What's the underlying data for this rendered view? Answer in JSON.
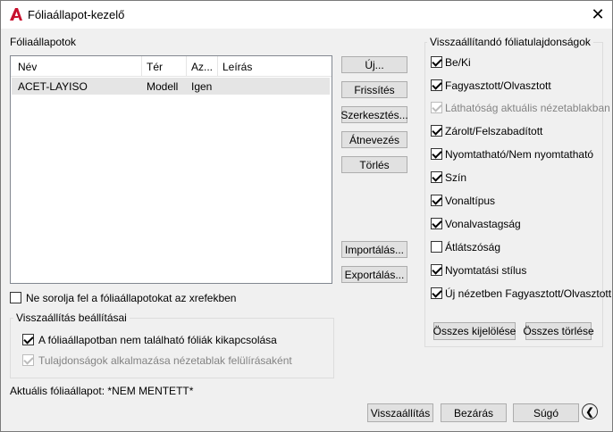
{
  "window": {
    "title": "Fóliaállapot-kezelő",
    "close_glyph": "✕",
    "app_icon": "autocad-icon"
  },
  "left": {
    "list_label": "Fóliaállapotok",
    "columns": [
      "Név",
      "Tér",
      "Az...",
      "Leírás"
    ],
    "rows": [
      {
        "name": "ACET-LAYISO",
        "space": "Modell",
        "az": "Igen",
        "desc": ""
      }
    ],
    "xref_checkbox": {
      "label": "Ne sorolja fel a fóliaállapotokat az xrefekben",
      "checked": false
    },
    "restore_group": {
      "title": "Visszaállítás beállításai",
      "opt1": {
        "label": "A fóliaállapotban nem található fóliák kikapcsolása",
        "checked": true
      },
      "opt2": {
        "label": "Tulajdonságok alkalmazása nézetablak felülírásaként",
        "checked": true,
        "disabled": true
      }
    },
    "current_state": "Aktuális fóliaállapot: *NEM MENTETT*"
  },
  "middle_buttons": {
    "new": "Új...",
    "refresh": "Frissítés",
    "edit": "Szerkesztés...",
    "rename": "Átnevezés",
    "delete": "Törlés",
    "import": "Importálás...",
    "export": "Exportálás..."
  },
  "right": {
    "group_title": "Visszaállítandó fóliatulajdonságok",
    "props": [
      {
        "label": "Be/Ki",
        "checked": true,
        "disabled": false
      },
      {
        "label": "Fagyasztott/Olvasztott",
        "checked": true,
        "disabled": false
      },
      {
        "label": "Láthatóság aktuális nézetablakban",
        "checked": true,
        "disabled": true
      },
      {
        "label": "Zárolt/Felszabadított",
        "checked": true,
        "disabled": false
      },
      {
        "label": "Nyomtatható/Nem nyomtatható",
        "checked": true,
        "disabled": false
      },
      {
        "label": "Szín",
        "checked": true,
        "disabled": false
      },
      {
        "label": "Vonaltípus",
        "checked": true,
        "disabled": false
      },
      {
        "label": "Vonalvastagság",
        "checked": true,
        "disabled": false
      },
      {
        "label": "Átlátszóság",
        "checked": false,
        "disabled": false
      },
      {
        "label": "Nyomtatási stílus",
        "checked": true,
        "disabled": false
      },
      {
        "label": "Új nézetben Fagyasztott/Olvasztott",
        "checked": true,
        "disabled": false
      }
    ],
    "select_all": "Összes kijelölése",
    "clear_all": "Összes törlése"
  },
  "footer": {
    "restore": "Visszaállítás",
    "close": "Bezárás",
    "help": "Súgó",
    "collapse_icon": "chevron-left-circle-icon"
  },
  "colors": {
    "accent_red": "#c8102e",
    "selected_row": "#e5e5e5"
  }
}
